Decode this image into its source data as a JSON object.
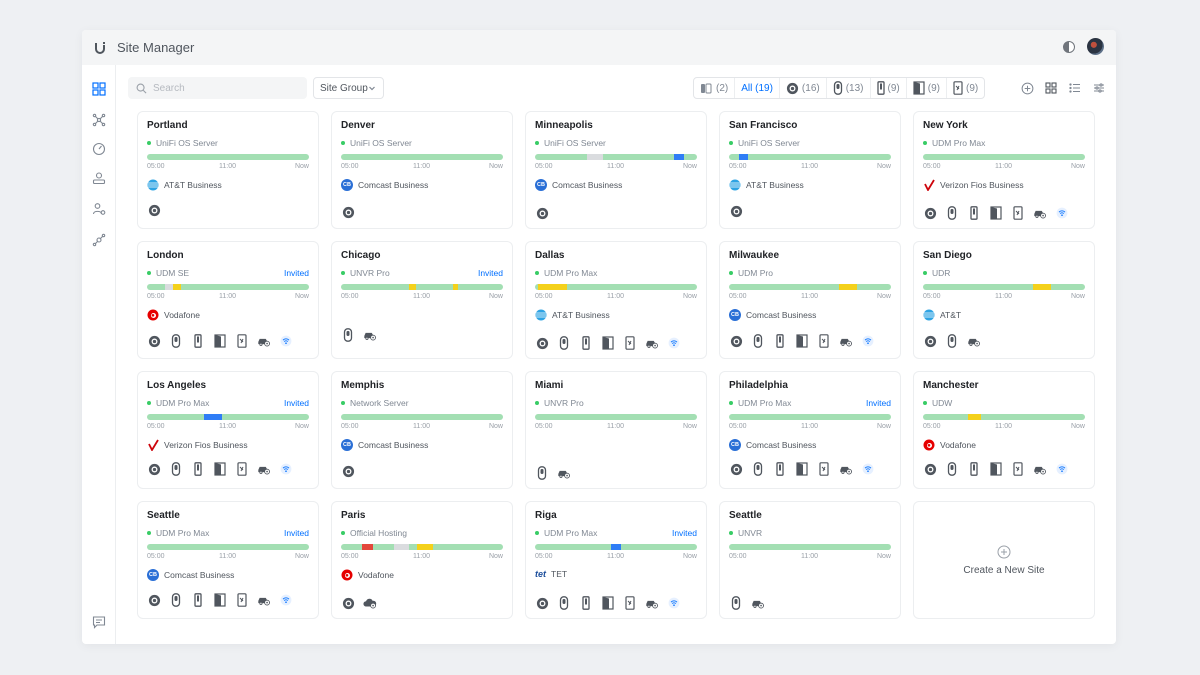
{
  "app": {
    "title": "Site Manager"
  },
  "toolbar": {
    "search_placeholder": "Search",
    "site_group_label": "Site Group",
    "filters": [
      {
        "icon": "gateway-icon",
        "label": "(2)"
      },
      {
        "icon": "none",
        "label": "All (19)",
        "active": true
      },
      {
        "icon": "camera-icon",
        "label": "(16)"
      },
      {
        "icon": "access-point-icon",
        "label": "(13)"
      },
      {
        "icon": "phone-icon",
        "label": "(9)"
      },
      {
        "icon": "door-icon",
        "label": "(9)"
      },
      {
        "icon": "intercom-icon",
        "label": "(9)"
      }
    ]
  },
  "sites": [
    {
      "name": "Portland",
      "device": "UniFi OS Server",
      "invited": "",
      "isp": "AT&T Business",
      "isp_logo": "att",
      "segments": [],
      "icons": [
        "camera"
      ]
    },
    {
      "name": "Denver",
      "device": "UniFi OS Server",
      "invited": "",
      "isp": "Comcast Business",
      "isp_logo": "comcast",
      "segments": [],
      "icons": [
        "camera"
      ]
    },
    {
      "name": "Minneapolis",
      "device": "UniFi OS Server",
      "invited": "",
      "isp": "Comcast Business",
      "isp_logo": "comcast",
      "segments": [
        {
          "from": 0.32,
          "to": 0.42,
          "color": "#dadcdf"
        },
        {
          "from": 0.86,
          "to": 0.92,
          "color": "#2f7df6"
        }
      ],
      "icons": [
        "camera"
      ]
    },
    {
      "name": "San Francisco",
      "device": "UniFi OS Server",
      "invited": "",
      "isp": "AT&T Business",
      "isp_logo": "att",
      "segments": [
        {
          "from": 0.06,
          "to": 0.12,
          "color": "#2f7df6"
        }
      ],
      "icons": [
        "camera"
      ]
    },
    {
      "name": "New York",
      "device": "UDM Pro Max",
      "invited": "",
      "isp": "Verizon Fios Business",
      "isp_logo": "verizon",
      "segments": [],
      "icons": [
        "camera",
        "ap",
        "phone",
        "door",
        "intercom",
        "car",
        "wifi"
      ]
    },
    {
      "name": "London",
      "device": "UDM SE",
      "invited": "Invited",
      "isp": "Vodafone",
      "isp_logo": "vodafone",
      "segments": [
        {
          "from": 0.11,
          "to": 0.16,
          "color": "#dadcdf"
        },
        {
          "from": 0.16,
          "to": 0.21,
          "color": "#f4d11b"
        }
      ],
      "icons": [
        "camera",
        "ap",
        "phone",
        "door",
        "intercom",
        "car",
        "wifi"
      ]
    },
    {
      "name": "Chicago",
      "device": "UNVR Pro",
      "invited": "Invited",
      "isp": "",
      "isp_logo": "",
      "segments": [
        {
          "from": 0.42,
          "to": 0.46,
          "color": "#f4d11b"
        },
        {
          "from": 0.69,
          "to": 0.72,
          "color": "#f4d11b"
        }
      ],
      "icons": [
        "ap",
        "car"
      ]
    },
    {
      "name": "Dallas",
      "device": "UDM Pro Max",
      "invited": "",
      "isp": "AT&T Business",
      "isp_logo": "att",
      "segments": [
        {
          "from": 0.02,
          "to": 0.2,
          "color": "#f4d11b"
        }
      ],
      "icons": [
        "camera",
        "ap",
        "phone",
        "door",
        "intercom",
        "car",
        "wifi"
      ]
    },
    {
      "name": "Milwaukee",
      "device": "UDM Pro",
      "invited": "",
      "isp": "Comcast Business",
      "isp_logo": "comcast",
      "segments": [
        {
          "from": 0.68,
          "to": 0.79,
          "color": "#f4d11b"
        }
      ],
      "icons": [
        "camera",
        "ap",
        "phone",
        "door",
        "intercom",
        "car",
        "wifi"
      ]
    },
    {
      "name": "San Diego",
      "device": "UDR",
      "invited": "",
      "isp": "AT&T",
      "isp_logo": "att",
      "segments": [
        {
          "from": 0.68,
          "to": 0.79,
          "color": "#f4d11b"
        }
      ],
      "icons": [
        "camera",
        "ap",
        "car"
      ]
    },
    {
      "name": "Los Angeles",
      "device": "UDM Pro Max",
      "invited": "Invited",
      "isp": "Verizon Fios Business",
      "isp_logo": "verizon",
      "segments": [
        {
          "from": 0.35,
          "to": 0.46,
          "color": "#2f7df6"
        }
      ],
      "icons": [
        "camera",
        "ap",
        "phone",
        "door",
        "intercom",
        "car",
        "wifi"
      ]
    },
    {
      "name": "Memphis",
      "device": "Network Server",
      "invited": "",
      "isp": "Comcast Business",
      "isp_logo": "comcast",
      "segments": [],
      "icons": [
        "camera"
      ]
    },
    {
      "name": "Miami",
      "device": "UNVR Pro",
      "invited": "",
      "isp": "",
      "isp_logo": "",
      "segments": [],
      "icons": [
        "ap",
        "car"
      ]
    },
    {
      "name": "Philadelphia",
      "device": "UDM Pro Max",
      "invited": "Invited",
      "isp": "Comcast Business",
      "isp_logo": "comcast",
      "segments": [],
      "icons": [
        "camera",
        "ap",
        "phone",
        "door",
        "intercom",
        "car",
        "wifi"
      ]
    },
    {
      "name": "Manchester",
      "device": "UDW",
      "invited": "",
      "isp": "Vodafone",
      "isp_logo": "vodafone",
      "segments": [
        {
          "from": 0.28,
          "to": 0.36,
          "color": "#f4d11b"
        }
      ],
      "icons": [
        "camera",
        "ap",
        "phone",
        "door",
        "intercom",
        "car",
        "wifi"
      ]
    },
    {
      "name": "Seattle",
      "device": "UDM Pro Max",
      "invited": "Invited",
      "isp": "Comcast Business",
      "isp_logo": "comcast",
      "segments": [],
      "icons": [
        "camera",
        "ap",
        "phone",
        "door",
        "intercom",
        "car",
        "wifi"
      ]
    },
    {
      "name": "Paris",
      "device": "Official Hosting",
      "invited": "",
      "isp": "Vodafone",
      "isp_logo": "vodafone",
      "segments": [
        {
          "from": 0.13,
          "to": 0.2,
          "color": "#e3473b"
        },
        {
          "from": 0.33,
          "to": 0.42,
          "color": "#dadcdf"
        },
        {
          "from": 0.47,
          "to": 0.57,
          "color": "#f4d11b"
        }
      ],
      "icons": [
        "camera",
        "cloud"
      ]
    },
    {
      "name": "Riga",
      "device": "UDM Pro Max",
      "invited": "Invited",
      "isp": "TET",
      "isp_logo": "tet",
      "segments": [
        {
          "from": 0.47,
          "to": 0.53,
          "color": "#2f7df6"
        }
      ],
      "icons": [
        "camera",
        "ap",
        "phone",
        "door",
        "intercom",
        "car",
        "wifi"
      ]
    },
    {
      "name": "Seattle",
      "device": "UNVR",
      "invited": "",
      "isp": "",
      "isp_logo": "",
      "segments": [],
      "icons": [
        "ap",
        "car"
      ]
    }
  ],
  "times": {
    "start": "05:00",
    "mid": "11:00",
    "end": "Now"
  },
  "create_site_label": "Create a New Site",
  "isp_logos": {
    "comcast": {
      "text": "CB",
      "color": "#2a6fd6"
    },
    "att": {
      "text": "",
      "color": "#2ea3e3"
    },
    "vodafone": {
      "text": "",
      "color": "#e60000"
    },
    "verizon": {
      "text": "",
      "color": "#cd040b"
    },
    "tet": {
      "text": "tet",
      "color": "#1d4f9c"
    }
  }
}
